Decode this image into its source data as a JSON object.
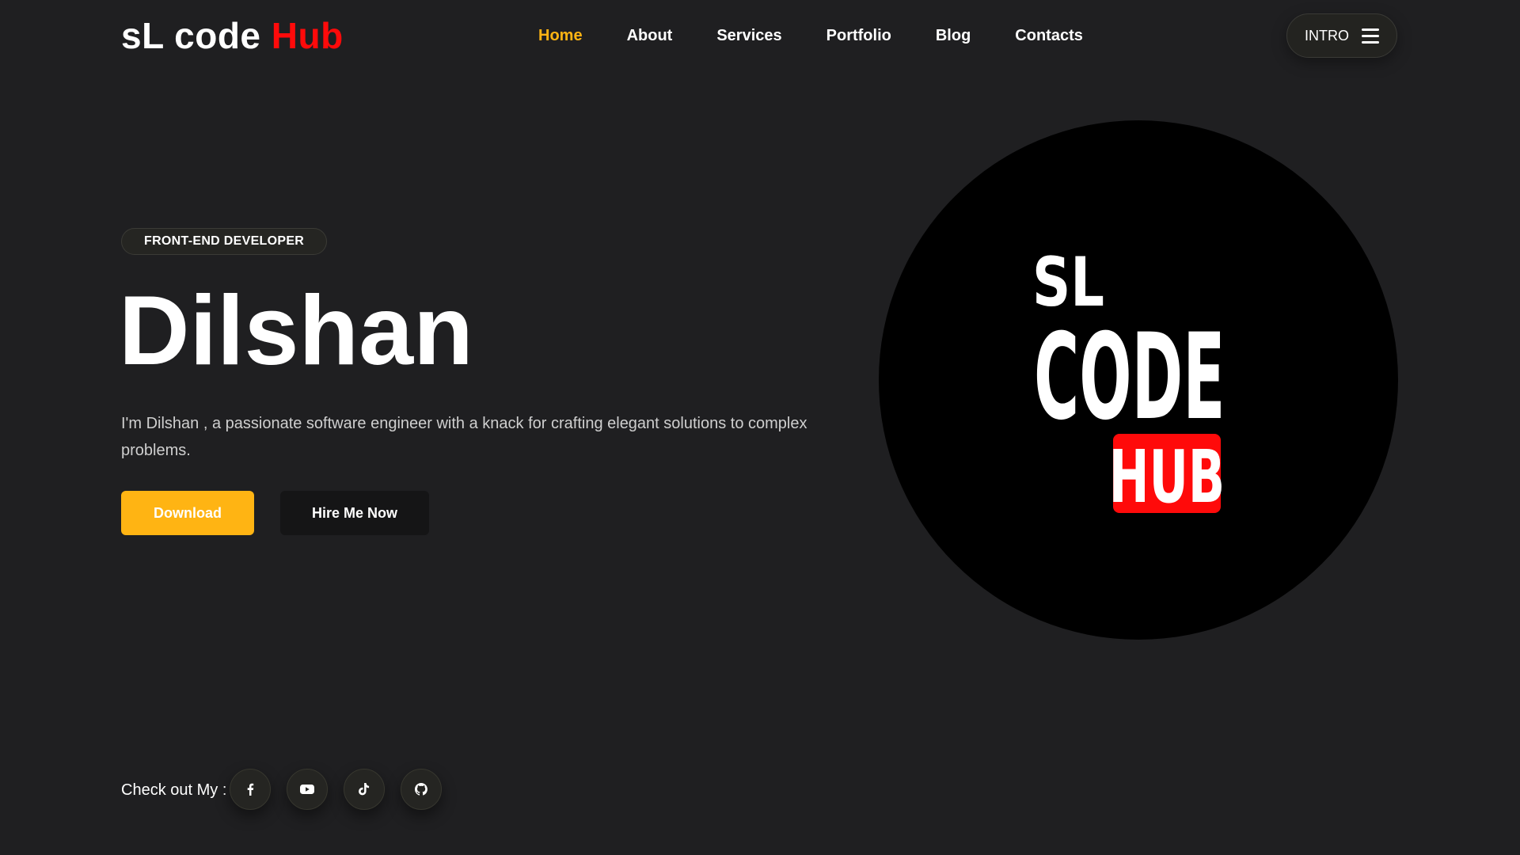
{
  "header": {
    "logo": {
      "part1": "sL code",
      "part2": "Hub"
    },
    "nav": [
      {
        "label": "Home",
        "active": true
      },
      {
        "label": "About"
      },
      {
        "label": "Services"
      },
      {
        "label": "Portfolio"
      },
      {
        "label": "Blog"
      },
      {
        "label": "Contacts"
      }
    ],
    "intro_button": {
      "label": "INTRO",
      "icon": "hamburger-menu-icon"
    }
  },
  "hero": {
    "badge": "FRONT-END DEVELOPER",
    "name": "Dilshan",
    "description": "I'm Dilshan , a passionate software engineer with a knack for crafting elegant solutions to complex problems.",
    "download_label": "Download",
    "hire_label": "Hire Me Now",
    "image_logo": {
      "line1": "SL",
      "line2": "CODE",
      "line3": "HUB"
    }
  },
  "socials": {
    "label": "Check out My :",
    "items": [
      {
        "icon": "facebook-icon"
      },
      {
        "icon": "youtube-icon"
      },
      {
        "icon": "tiktok-icon"
      },
      {
        "icon": "github-icon"
      }
    ]
  },
  "colors": {
    "background": "#1f1f21",
    "accent": "#ffb413",
    "brand_red": "#ff0a0a",
    "text": "#ffffff"
  }
}
